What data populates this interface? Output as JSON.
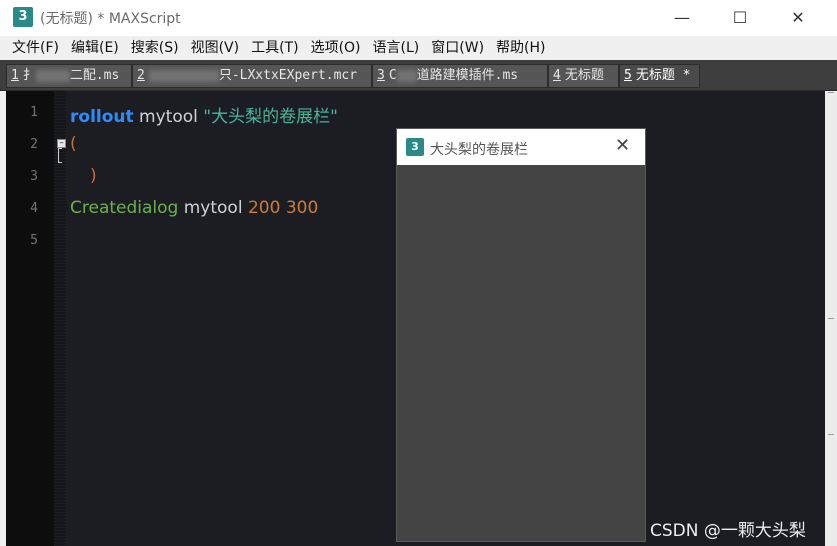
{
  "window": {
    "title": "(无标题) * MAXScript",
    "app_icon": "3ds-max-icon",
    "controls": {
      "minimize": "—",
      "maximize": "☐",
      "close": "✕"
    }
  },
  "menu": [
    "文件(F)",
    "编辑(E)",
    "搜索(S)",
    "视图(V)",
    "工具(T)",
    "选项(O)",
    "语言(L)",
    "窗口(W)",
    "帮助(H)"
  ],
  "tabs": [
    {
      "num": "1",
      "before": "扌",
      "after": "二配.ms"
    },
    {
      "num": "2",
      "before": "",
      "after": "只-LXxtxEXpert.mcr"
    },
    {
      "num": "3",
      "before": "C",
      "after": "道路建模插件.ms"
    },
    {
      "num": "4",
      "label": "无标题"
    },
    {
      "num": "5",
      "label": "无标题 *"
    }
  ],
  "editor": {
    "line_numbers": [
      "1",
      "2",
      "3",
      "4",
      "5"
    ],
    "line1": {
      "keyword": "rollout",
      "name": "mytool",
      "string": "\"大头梨的卷展栏\""
    },
    "line2": {
      "paren": "("
    },
    "line3": {
      "paren": ")"
    },
    "line4": {
      "func": "Createdialog",
      "name": "mytool",
      "width": "200",
      "height": "300"
    }
  },
  "dialog": {
    "title": "大头梨的卷展栏",
    "icon": "3ds-max-icon",
    "close": "✕"
  },
  "watermark": "CSDN @一颗大头梨"
}
